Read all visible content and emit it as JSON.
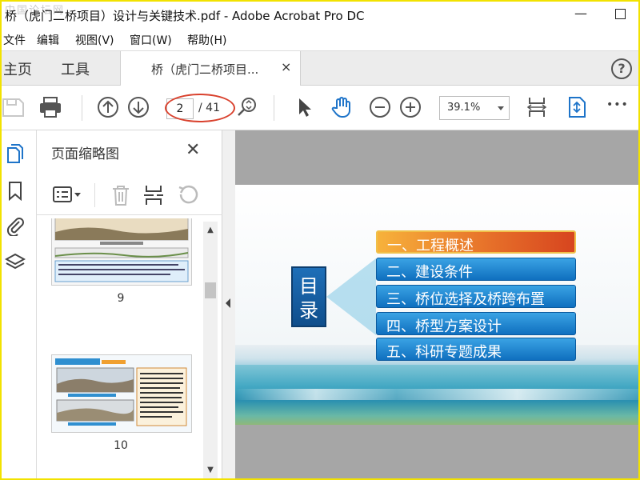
{
  "window": {
    "title": "桥（虎门二桥项目）设计与关键技术.pdf - Adobe Acrobat Pro DC",
    "watermark": "中国论坛网",
    "minimize_label": "—"
  },
  "menu": {
    "items": [
      "文件",
      "编辑",
      "视图(V)",
      "窗口(W)",
      "帮助(H)"
    ]
  },
  "tabs": {
    "home": "主页",
    "tools": "工具",
    "doc": "桥（虎门二桥项目...",
    "close": "×",
    "help": "?"
  },
  "toolbar": {
    "current_page": "2",
    "total_pages": "/ 41",
    "zoom": "39.1%",
    "more": "•••"
  },
  "panel": {
    "title": "页面缩略图",
    "close": "✕",
    "thumbnails": [
      {
        "label": "9"
      },
      {
        "label": "10"
      }
    ]
  },
  "slide": {
    "heading": "目录",
    "items": [
      "一、工程概述",
      "二、建设条件",
      "三、桥位选择及桥跨布置",
      "四、桥型方案设计",
      "五、科研专题成果"
    ],
    "active_index": 0
  },
  "colors": {
    "accent_blue": "#0f6fbf",
    "active_orange": "#e7722a",
    "annotation_red": "#d9412d",
    "window_border": "#f2e200"
  }
}
